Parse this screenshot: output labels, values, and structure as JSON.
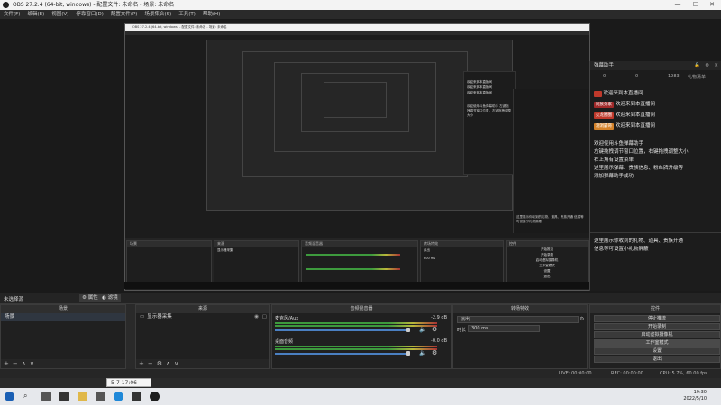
{
  "window": {
    "title": "OBS 27.2.4 (64-bit, windows) - 配置文件: 未命名 - 场景: 未命名",
    "controls": [
      "—",
      "☐",
      "✕"
    ]
  },
  "menu": [
    "文件(F)",
    "编辑(E)",
    "视图(V)",
    "停靠窗口(D)",
    "配置文件(P)",
    "场景集合(S)",
    "工具(T)",
    "帮助(H)"
  ],
  "inner": {
    "title": "OBS 27.2.4 (64-bit, windows) - 配置文件: 未命名 - 场景: 未命名",
    "chat_lines": [
      "欢迎来到本直播间",
      "欢迎来到本直播间",
      "欢迎来到本直播间"
    ],
    "help_text": "欢迎使用斗鱼弹幕助手 左键拖拽调节窗口位置，右键拖拽调整大小",
    "mini_help": "这里展示你收到的礼物、道具、贵族开通 信息等可设置小礼物屏蔽",
    "docks": {
      "scenes": "场景",
      "sources": "来源",
      "source_item": "显示器采集",
      "mixer": "音频混音器",
      "transitions": "转场特效",
      "transition_value": "淡出",
      "duration_value": "300 ms",
      "controls": "控件",
      "buttons": [
        "开始推流",
        "开始录制",
        "启动虚拟摄像机",
        "工作室模式",
        "设置",
        "退出"
      ]
    }
  },
  "chat": {
    "title": "弹幕助手",
    "stats": [
      "0",
      "0",
      "1983"
    ],
    "tab_label": "礼物清单",
    "messages": [
      {
        "badge": "…",
        "badge_class": "red",
        "text": "欢迎来到本直播间"
      },
      {
        "badge": "同族弟家",
        "badge_class": "red2",
        "text": "欢迎来到本直播间"
      },
      {
        "badge": "火龙圈圈",
        "badge_class": "red",
        "text": "欢迎来到本直播间"
      },
      {
        "badge": "洞洞霸哥",
        "badge_class": "orange",
        "text": "欢迎来到本直播间"
      }
    ],
    "help_lines": [
      "欢迎使用斗鱼弹幕助手",
      "左键拖拽调节窗口位置，右键拖拽调整大小",
      "右上角有设置菜单",
      "这里展示弹幕、贵族信息、粉丝牌升级等",
      "添加弹幕助手成功"
    ],
    "gift_lines": [
      "这里展示你收到的礼物、道具、贵族开通",
      "信息等可设置小礼物屏蔽"
    ]
  },
  "scenebar": {
    "no_source": "未选择源",
    "properties": "属性",
    "filters": "滤镜"
  },
  "scenes_dock": {
    "title": "场景",
    "items": [
      "场景"
    ],
    "footer": [
      "+",
      "−",
      "∧",
      "∨"
    ]
  },
  "sources_dock": {
    "title": "来源",
    "items": [
      "显示器采集"
    ],
    "footer": [
      "+",
      "−",
      "⚙",
      "∧",
      "∨"
    ]
  },
  "mixer_dock": {
    "title": "音频混音器",
    "channels": [
      {
        "name": "麦克风/Aux",
        "db": "-2.9 dB"
      },
      {
        "name": "桌面音频",
        "db": "-0.0 dB"
      }
    ]
  },
  "transitions_dock": {
    "title": "转场特效",
    "transition": "淡出",
    "duration_label": "时长",
    "duration": "300 ms"
  },
  "controls_dock": {
    "title": "控件",
    "buttons": [
      "停止推流",
      "开始录制",
      "启动虚拟摄像机",
      "工作室模式",
      "设置",
      "退出"
    ]
  },
  "status": {
    "dropped": "LIVE: 00:00:00",
    "rec": "REC: 00:00:00",
    "cpu": "CPU: 5.7%, 60.00 fps"
  },
  "tooltip": "5-7 17:06",
  "taskbar": {
    "time": "19:30",
    "date": "2022/5/10"
  },
  "colors": {
    "accent": "#4a7fc1",
    "meter_green": "#3d9a3d",
    "meter_yellow": "#b8b83a",
    "meter_red": "#a33333",
    "badge_red": "#c0392b",
    "badge_orange": "#d4822a"
  }
}
